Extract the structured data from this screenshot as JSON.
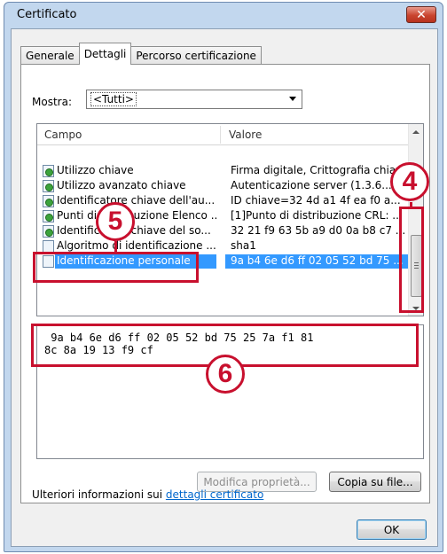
{
  "window": {
    "title": "Certificato",
    "close_label": "✕"
  },
  "tabs": [
    {
      "label": "Generale"
    },
    {
      "label": "Dettagli"
    },
    {
      "label": "Percorso certificazione"
    }
  ],
  "show": {
    "label": "Mostra:",
    "selected": "<Tutti>"
  },
  "list": {
    "columns": {
      "campo": "Campo",
      "valore": "Valore"
    },
    "rows": [
      {
        "campo": "Utilizzo chiave",
        "valore": "Firma digitale, Crittografia chia...",
        "icon": "cert-green-icon"
      },
      {
        "campo": "Utilizzo avanzato chiave",
        "valore": "Autenticazione server (1.3.6....",
        "icon": "cert-green-icon"
      },
      {
        "campo": "Identificatore chiave dell'au...",
        "valore": "ID chiave=32 4d a1 4f ea f0 a...",
        "icon": "cert-green-icon"
      },
      {
        "campo": "Punti di distribuzione Elenco ...",
        "valore": "[1]Punto di distribuzione CRL: ...",
        "icon": "cert-green-icon"
      },
      {
        "campo": "Identificatore chiave del so...",
        "valore": "32 21 f9 63 5b a9 d0 0a b8 c7 ...",
        "icon": "cert-green-icon"
      },
      {
        "campo": "Algoritmo di identificazione ...",
        "valore": "sha1",
        "icon": "document-icon"
      },
      {
        "campo": "Identificazione personale",
        "valore": "9a b4 6e d6 ff 02 05 52 bd 75 ...",
        "icon": "document-icon",
        "selected": true
      }
    ]
  },
  "detail": {
    "line1": " 9a b4 6e d6 ff 02 05 52 bd 75 25 7a f1 81",
    "line2": "8c 8a 19 13 f9 cf"
  },
  "buttons": {
    "modify": "Modifica proprietà...",
    "copy": "Copia su file...",
    "ok": "OK"
  },
  "info": {
    "prefix": "Ulteriori informazioni sui ",
    "link": "dettagli certificato"
  },
  "annotations": {
    "four": "4",
    "five": "5",
    "six": "6",
    "color": "#c8102e"
  }
}
